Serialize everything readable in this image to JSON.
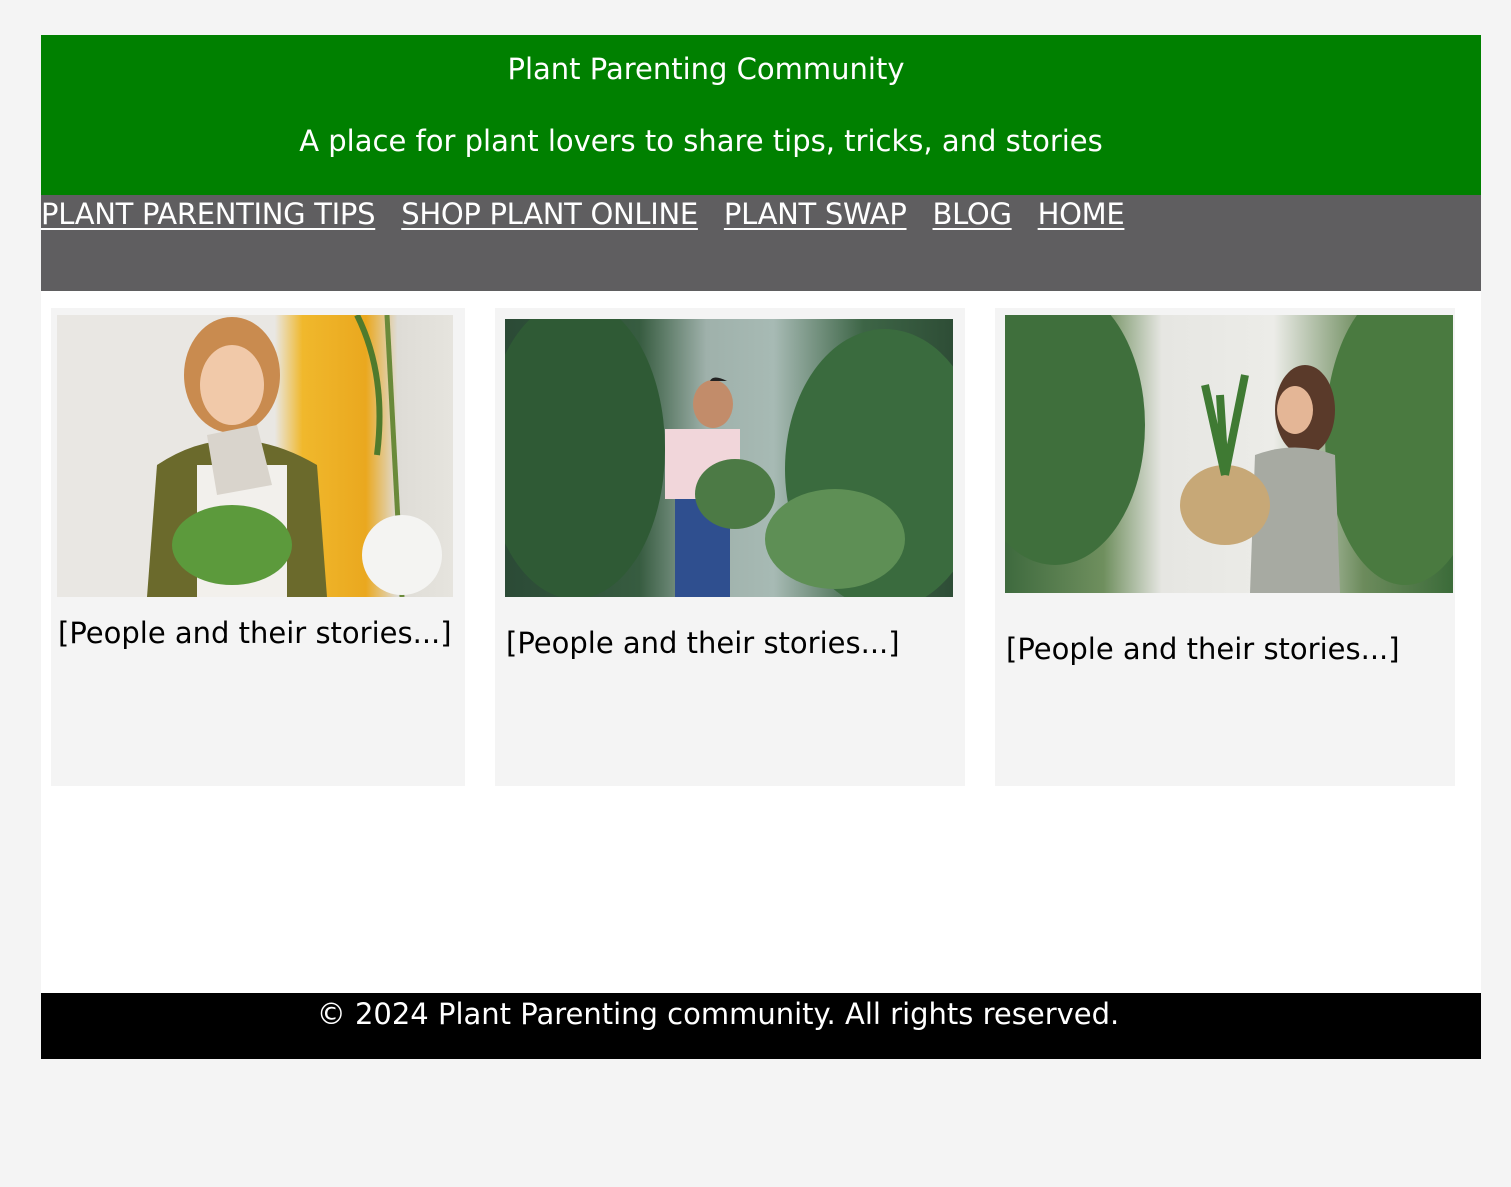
{
  "header": {
    "title": "Plant Parenting Community",
    "tagline": "A place for plant lovers to share tips, tricks, and stories"
  },
  "nav": {
    "items": [
      {
        "label": "PLANT PARENTING TIPS"
      },
      {
        "label": "SHOP PLANT ONLINE"
      },
      {
        "label": "PLANT SWAP"
      },
      {
        "label": "BLOG"
      },
      {
        "label": "HOME"
      }
    ]
  },
  "cards": [
    {
      "text": "[People and their stories...]",
      "image": "woman-watering-plant-photo"
    },
    {
      "text": "[People and their stories...]",
      "image": "man-among-plants-photo"
    },
    {
      "text": "[People and their stories...]",
      "image": "woman-holding-plant-basket-photo"
    }
  ],
  "footer": {
    "copyright": "© 2024 Plant Parenting community. All rights reserved."
  },
  "colors": {
    "header_bg": "#008000",
    "nav_bg": "#5f5e60",
    "footer_bg": "#000000",
    "page_bg": "#f4f4f4"
  }
}
